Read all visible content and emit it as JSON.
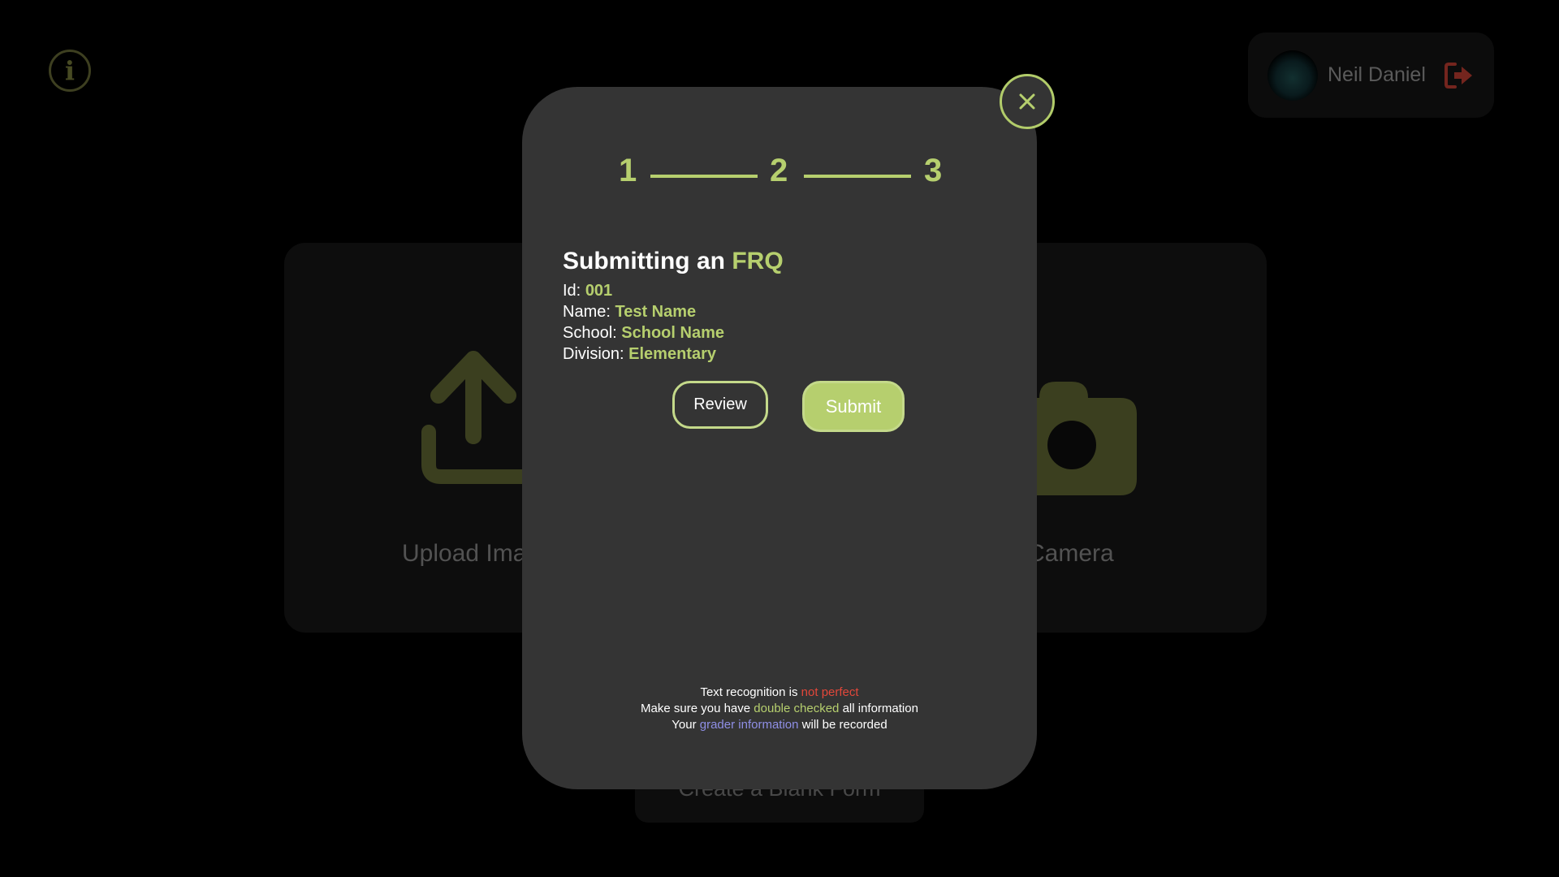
{
  "background": {
    "info_icon": "i",
    "user": {
      "name": "Neil Daniel",
      "avatar_icon": "avatar",
      "logout_icon": "logout-icon"
    },
    "upload_label": "Upload Ima",
    "camera_label": "e Camera",
    "blank_form_label": "Create a Blank Form"
  },
  "modal": {
    "close_icon": "close-icon",
    "steps": [
      "1",
      "2",
      "3"
    ],
    "title_prefix": "Submitting an",
    "title_accent": "FRQ",
    "fields": [
      {
        "label": "Id:",
        "value": "001"
      },
      {
        "label": "Name:",
        "value": "Test Name"
      },
      {
        "label": "School:",
        "value": "School Name"
      },
      {
        "label": "Division:",
        "value": "Elementary"
      }
    ],
    "review_label": "Review",
    "submit_label": "Submit",
    "notes": {
      "line1_prefix": "Text recognition is",
      "line1_highlight": "not perfect",
      "line2_prefix": "Make sure you have",
      "line2_highlight": "double checked",
      "line2_suffix": "all information",
      "line3_prefix": "Your",
      "line3_highlight": "grader information",
      "line3_suffix": "will be recorded"
    }
  },
  "colors": {
    "accent": "#b6cf6e",
    "modal_bg": "#343434",
    "warning": "#e2473a",
    "info": "#8f8fe6"
  }
}
